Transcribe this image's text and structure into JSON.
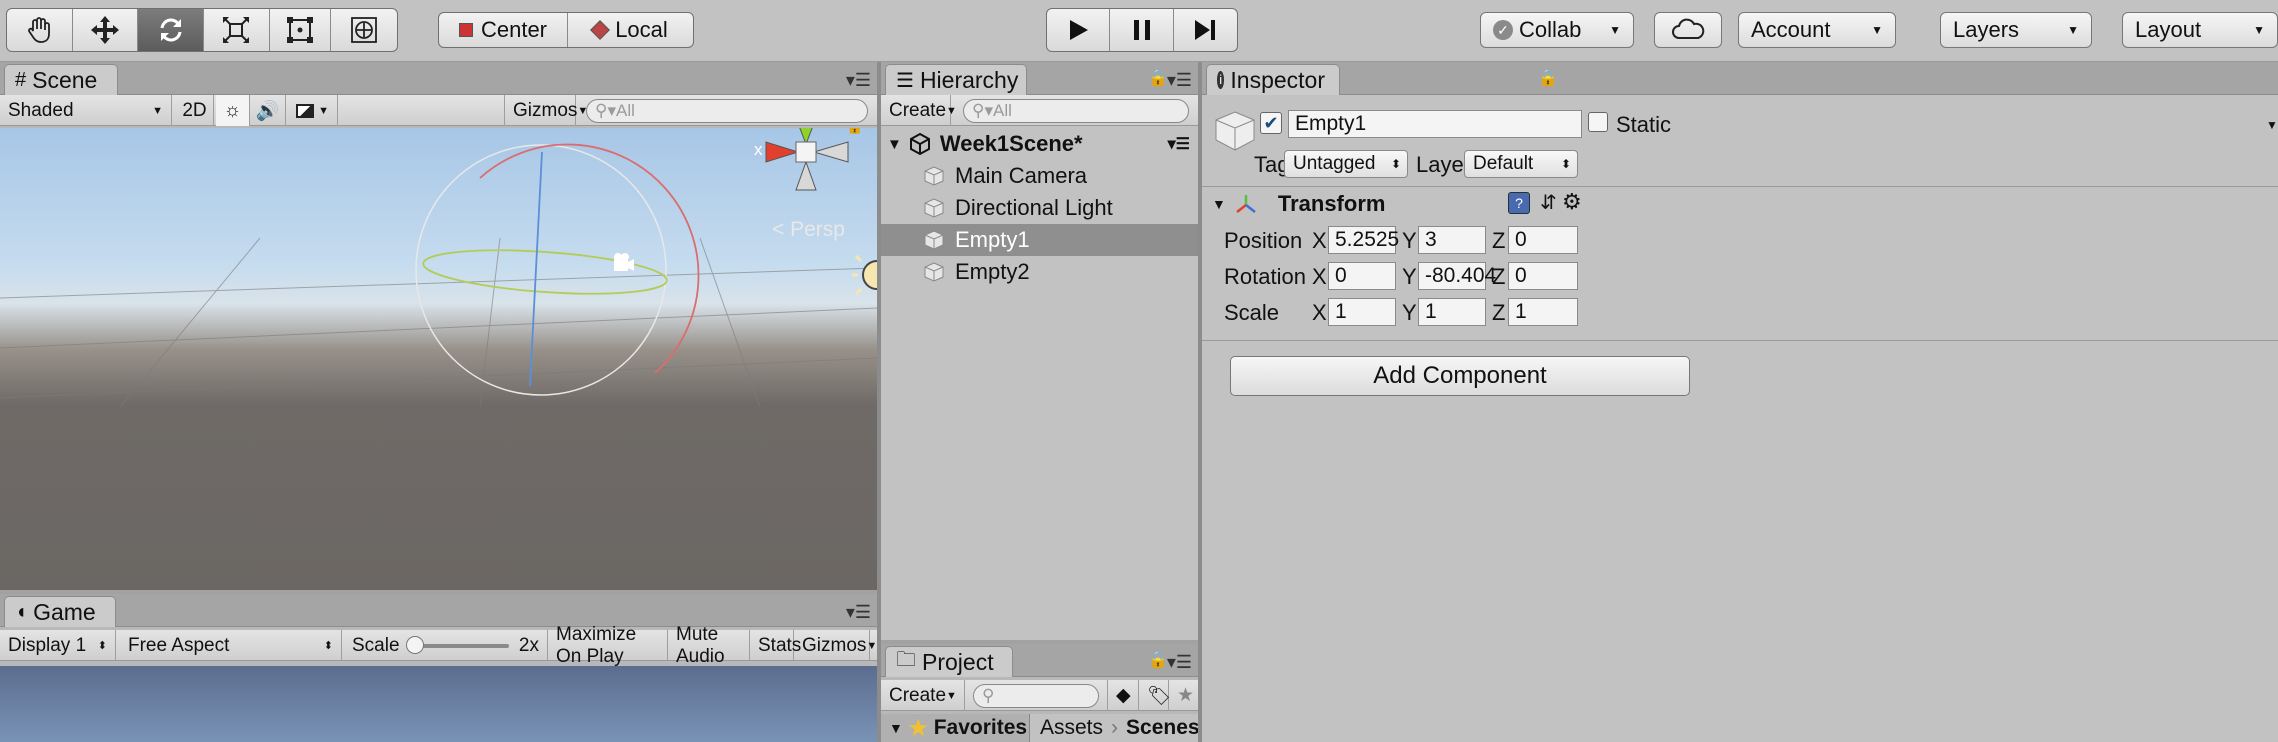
{
  "toolbar": {
    "tools": [
      {
        "name": "hand-tool",
        "icon": "hand-icon"
      },
      {
        "name": "move-tool",
        "icon": "move-icon"
      },
      {
        "name": "rotate-tool",
        "icon": "rotate-icon",
        "active": true
      },
      {
        "name": "scale-tool",
        "icon": "scale-icon"
      },
      {
        "name": "rect-tool",
        "icon": "rect-icon"
      },
      {
        "name": "transform-tool",
        "icon": "transform-icon"
      }
    ],
    "pivot_label": "Center",
    "space_label": "Local",
    "collab_label": "Collab",
    "account_label": "Account",
    "layers_label": "Layers",
    "layout_label": "Layout"
  },
  "scene": {
    "tab_label": "Scene",
    "shading_mode": "Shaded",
    "mode_2d": "2D",
    "gizmos_label": "Gizmos",
    "search_placeholder": "All",
    "gizmo_y": "y",
    "gizmo_x": "x",
    "persp_label": "Persp"
  },
  "game": {
    "tab_label": "Game",
    "display": "Display 1",
    "aspect": "Free Aspect",
    "scale_label": "Scale",
    "scale_value": "2x",
    "maximize_label": "Maximize On Play",
    "mute_label": "Mute Audio",
    "stats_label": "Stats",
    "gizmos_label": "Gizmos"
  },
  "hierarchy": {
    "tab_label": "Hierarchy",
    "create_label": "Create",
    "search_placeholder": "All",
    "scene_name": "Week1Scene*",
    "items": [
      {
        "label": "Main Camera",
        "selected": false
      },
      {
        "label": "Directional Light",
        "selected": false
      },
      {
        "label": "Empty1",
        "selected": true
      },
      {
        "label": "Empty2",
        "selected": false
      }
    ]
  },
  "project": {
    "tab_label": "Project",
    "create_label": "Create",
    "favorites_label": "Favorites",
    "breadcrumb": [
      "Assets",
      "Scenes"
    ]
  },
  "inspector": {
    "tab_label": "Inspector",
    "object_name": "Empty1",
    "static_label": "Static",
    "tag_label": "Tag",
    "tag_value": "Untagged",
    "layer_label": "Layer",
    "layer_value": "Default",
    "transform_label": "Transform",
    "position_label": "Position",
    "rotation_label": "Rotation",
    "scale_label": "Scale",
    "axis_x": "X",
    "axis_y": "Y",
    "axis_z": "Z",
    "position": {
      "x": "5.2525",
      "y": "3",
      "z": "0"
    },
    "rotation": {
      "x": "0",
      "y": "-80.404",
      "z": "0"
    },
    "scale": {
      "x": "1",
      "y": "1",
      "z": "1"
    },
    "add_component_label": "Add Component"
  },
  "colors": {
    "accent": "#2f6fc9",
    "gizmo_x": "#e0402d",
    "gizmo_y": "#8fd32a",
    "selection": "#8f8f8f"
  }
}
